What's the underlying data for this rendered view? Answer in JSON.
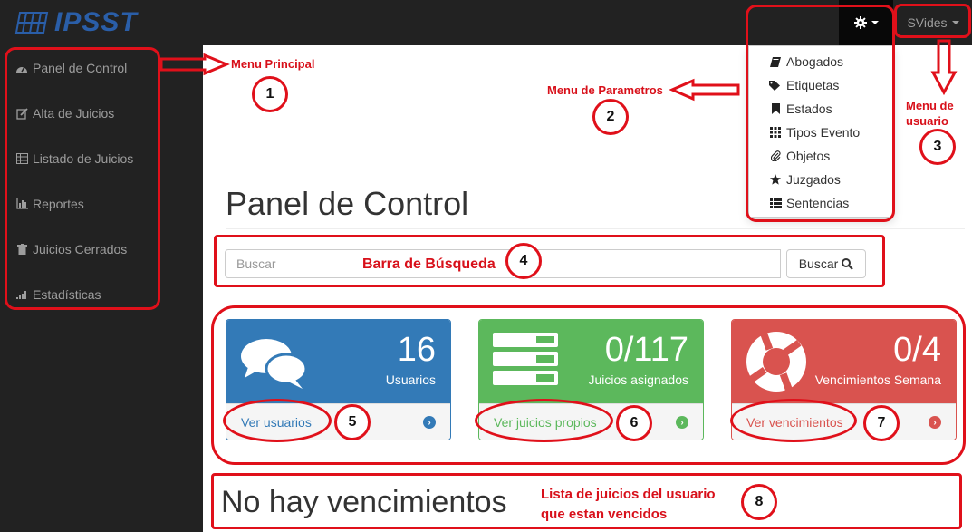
{
  "brand": {
    "name": "IPSST"
  },
  "navbar": {
    "settings_icon": "gear-icon",
    "user_label": "SVides"
  },
  "sidebar": {
    "items": [
      {
        "label": "Panel de Control",
        "icon": "dashboard-icon"
      },
      {
        "label": "Alta de Juicios",
        "icon": "edit-icon"
      },
      {
        "label": "Listado de Juicios",
        "icon": "table-icon"
      },
      {
        "label": "Reportes",
        "icon": "bar-chart-icon"
      },
      {
        "label": "Juicios Cerrados",
        "icon": "trash-icon"
      },
      {
        "label": "Estadísticas",
        "icon": "signal-icon"
      }
    ]
  },
  "settings_menu": {
    "items": [
      {
        "label": "Abogados",
        "icon": "book-icon"
      },
      {
        "label": "Etiquetas",
        "icon": "tags-icon"
      },
      {
        "label": "Estados",
        "icon": "bookmark-icon"
      },
      {
        "label": "Tipos Evento",
        "icon": "grid-icon"
      },
      {
        "label": "Objetos",
        "icon": "paperclip-icon"
      },
      {
        "label": "Juzgados",
        "icon": "star-icon"
      },
      {
        "label": "Sentencias",
        "icon": "list-icon"
      }
    ]
  },
  "main": {
    "title": "Panel de Control",
    "search": {
      "placeholder": "Buscar",
      "button_label": "Buscar"
    },
    "panels": [
      {
        "value": "16",
        "label": "Usuarios",
        "link": "Ver usuarios",
        "color": "#337ab7",
        "icon": "comments-icon"
      },
      {
        "value": "0/117",
        "label": "Juicios asignados",
        "link": "Ver juicios propios",
        "color": "#5cb85c",
        "icon": "tasks-icon"
      },
      {
        "value": "0/4",
        "label": "Vencimientos Semana",
        "link": "Ver vencimientos",
        "color": "#d9534f",
        "icon": "support-icon"
      }
    ],
    "no_due_text": "No hay vencimientos"
  },
  "annotations": {
    "labels": [
      "Menu Principal",
      "Menu de Parametros",
      "Menu de usuario",
      "Barra de Búsqueda",
      "Lista de juicios del usuario que estan vencidos"
    ],
    "numbers": [
      "1",
      "2",
      "3",
      "4",
      "5",
      "6",
      "7",
      "8"
    ],
    "color": "#e0101a"
  }
}
